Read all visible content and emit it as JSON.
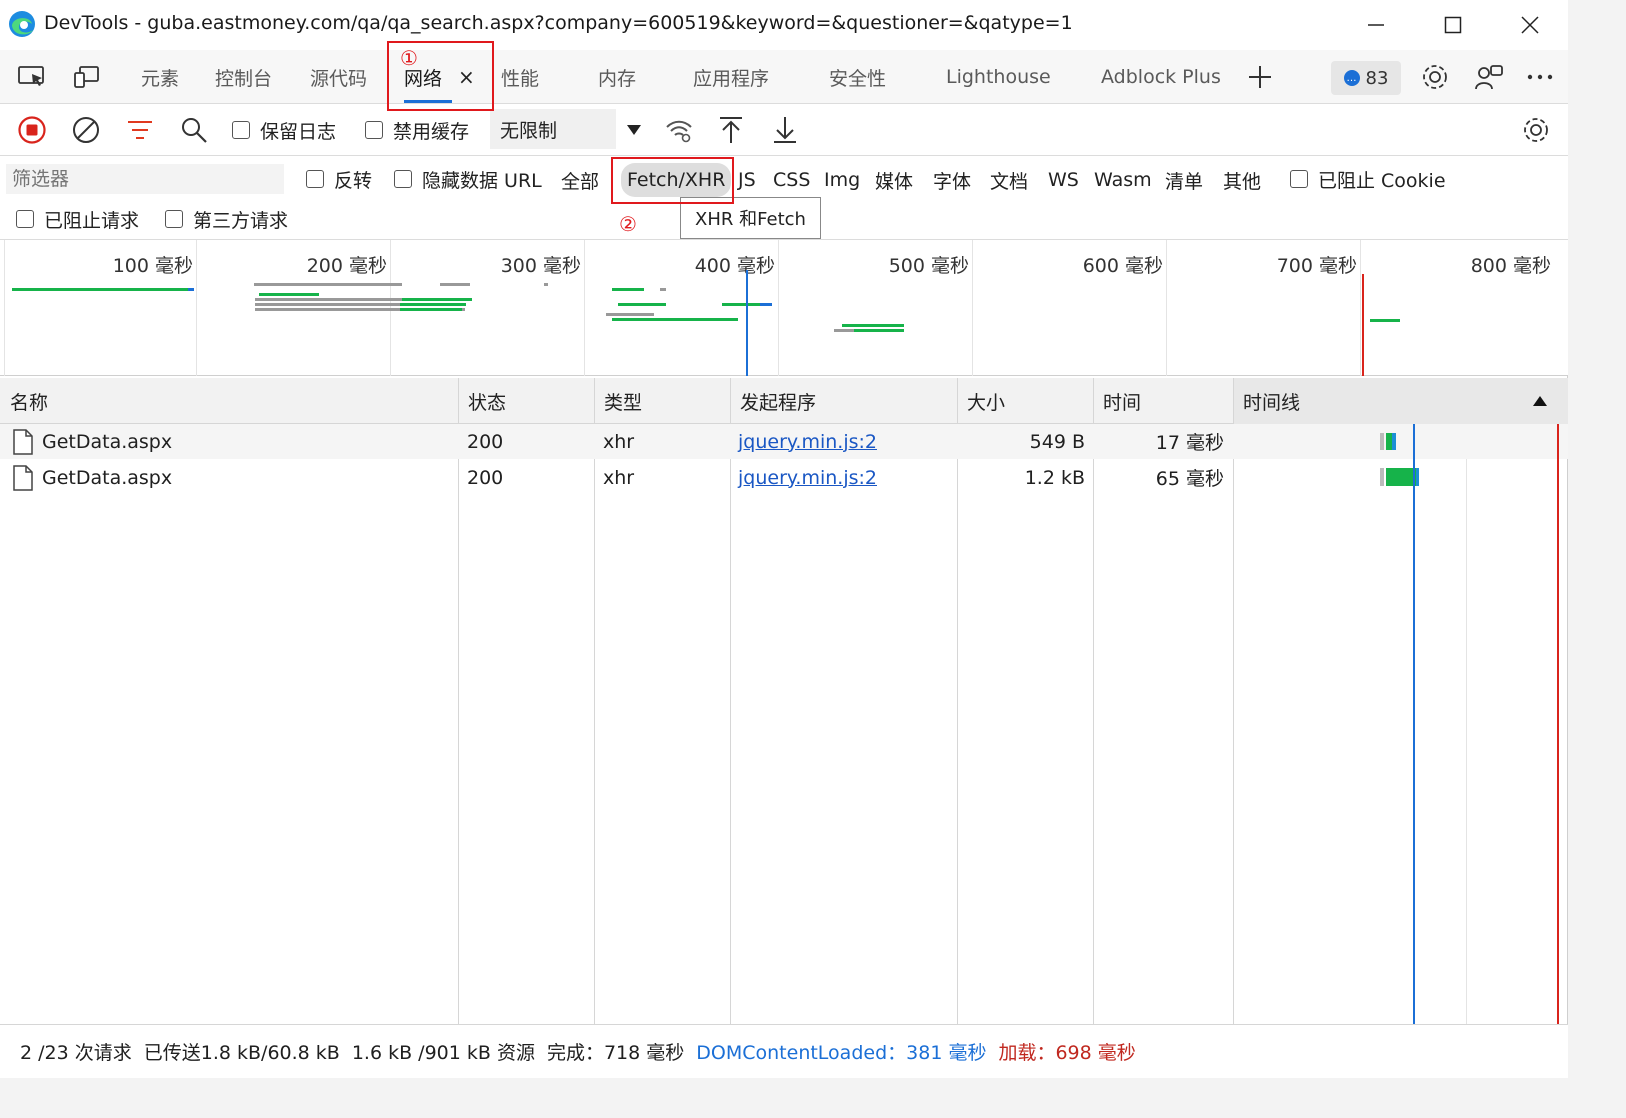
{
  "window": {
    "title": "DevTools - guba.eastmoney.com/qa/qa_search.aspx?company=600519&keyword=&questioner=&qatype=1"
  },
  "tabs": [
    {
      "label": "元素"
    },
    {
      "label": "控制台"
    },
    {
      "label": "源代码"
    },
    {
      "label": "网络",
      "active": true
    },
    {
      "label": "性能"
    },
    {
      "label": "内存"
    },
    {
      "label": "应用程序"
    },
    {
      "label": "安全性"
    },
    {
      "label": "Lighthouse"
    },
    {
      "label": "Adblock Plus"
    }
  ],
  "tab_close": "×",
  "issues_count": "83",
  "annotations": {
    "one": "①",
    "two": "②"
  },
  "toolbar": {
    "preserve_log": "保留日志",
    "disable_cache": "禁用缓存",
    "throttling": "无限制"
  },
  "filter": {
    "placeholder": "筛选器",
    "invert": "反转",
    "hide_data_urls": "隐藏数据 URL",
    "types": [
      "全部",
      "Fetch/XHR",
      "JS",
      "CSS",
      "Img",
      "媒体",
      "字体",
      "文档",
      "WS",
      "Wasm",
      "清单",
      "其他"
    ],
    "selected_type": "Fetch/XHR",
    "blocked_cookies": "已阻止 Cookie",
    "blocked_requests": "已阻止请求",
    "third_party": "第三方请求",
    "tooltip": "XHR 和Fetch"
  },
  "overview": {
    "labels": [
      "100 毫秒",
      "200 毫秒",
      "300 毫秒",
      "400 毫秒",
      "500 毫秒",
      "600 毫秒",
      "700 毫秒",
      "800 毫秒"
    ]
  },
  "table": {
    "columns": [
      "名称",
      "状态",
      "类型",
      "发起程序",
      "大小",
      "时间",
      "时间线"
    ],
    "rows": [
      {
        "name": "GetData.aspx",
        "status": "200",
        "type": "xhr",
        "initiator": "jquery.min.js:2",
        "size": "549 B",
        "time": "17 毫秒"
      },
      {
        "name": "GetData.aspx",
        "status": "200",
        "type": "xhr",
        "initiator": "jquery.min.js:2",
        "size": "1.2 kB",
        "time": "65 毫秒"
      }
    ]
  },
  "status": {
    "requests": "2 /23 次请求",
    "transferred": "已传送1.8 kB/60.8 kB",
    "resources": "1.6 kB /901 kB 资源",
    "finish": "完成：718 毫秒",
    "dom_content_loaded": "DOMContentLoaded：381 毫秒",
    "load": "加载：698 毫秒"
  },
  "colors": {
    "accent": "#1b6fd6",
    "record": "#d9241c",
    "annotation": "#e0191d",
    "bar_green": "#16b34a"
  }
}
